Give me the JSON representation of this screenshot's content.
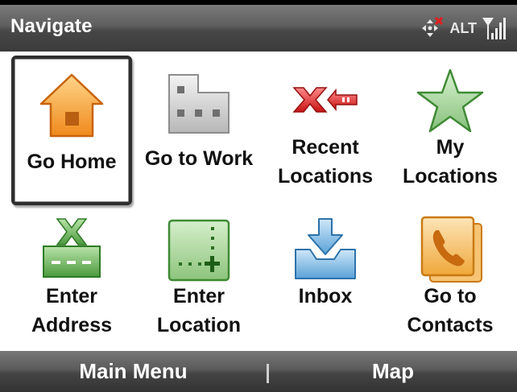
{
  "title": "Navigate",
  "status": {
    "alt": "ALT",
    "icons": [
      "network-disconnected-icon",
      "signal-strength-icon"
    ]
  },
  "tiles": [
    {
      "label": "Go Home",
      "icon": "home-icon",
      "selected": true
    },
    {
      "label": "Go to Work",
      "icon": "building-icon"
    },
    {
      "label": "Recent\nLocations",
      "icon": "recent-locations-icon"
    },
    {
      "label": "My\nLocations",
      "icon": "star-icon"
    },
    {
      "label": "Enter\nAddress",
      "icon": "enter-address-icon"
    },
    {
      "label": "Enter\nLocation",
      "icon": "enter-location-icon"
    },
    {
      "label": "Inbox",
      "icon": "inbox-icon"
    },
    {
      "label": "Go to\nContacts",
      "icon": "contacts-icon"
    }
  ],
  "softkeys": {
    "left": "Main Menu",
    "right": "Map"
  }
}
